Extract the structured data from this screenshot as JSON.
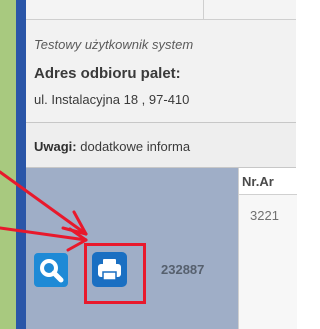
{
  "info": {
    "user_line": "Testowy użytkownik system",
    "address_label": "Adres odbioru palet:",
    "address_value": "ul. Instalacyjna 18 , 97-410"
  },
  "notes": {
    "label": "Uwagi:",
    "value": "dodatkowe informa"
  },
  "table": {
    "header": "Nr.Ar",
    "cell_value": "3221",
    "order_id": "232887"
  },
  "icons": {
    "search": "search-icon",
    "print": "print-icon"
  },
  "colors": {
    "highlight": "#e8192c",
    "button_blue": "#1e8ad6",
    "row_background": "#9faec7",
    "left_strip_green": "#a8c97f",
    "left_strip_blue": "#2a56a8"
  }
}
